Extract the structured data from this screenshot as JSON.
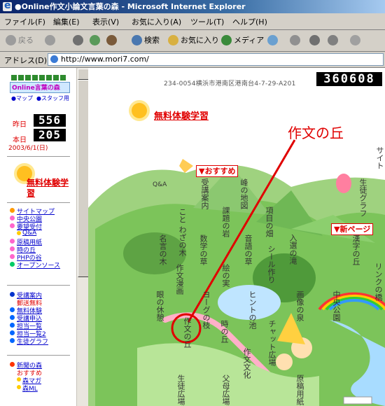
{
  "window": {
    "title": "●Online作文小論文言葉の森 - Microsoft Internet Explorer"
  },
  "menu": [
    "ファイル(F)",
    "編集(E)",
    "表示(V)",
    "お気に入り(A)",
    "ツール(T)",
    "ヘルプ(H)"
  ],
  "toolbar": {
    "back": "戻る",
    "search": "検索",
    "favorites": "お気に入り",
    "media": "メディア"
  },
  "address": {
    "label": "アドレス(D)",
    "url": "http://www.mori7.com/"
  },
  "sidebar": {
    "logo_text": "Online言葉の森",
    "mini_links": [
      "●マップ",
      "●スタッフ用"
    ],
    "yesterday_label": "昨日",
    "yesterday_count": "556",
    "today_label": "本日",
    "today_count": "205",
    "date": "2003/6/1(日)",
    "trial_label": "無料体験学習",
    "nav": [
      {
        "label": "サイトマップ",
        "color": "#ff9900",
        "indent": false
      },
      {
        "label": "中央公園",
        "color": "#ff66cc",
        "indent": false
      },
      {
        "label": "要望受付",
        "color": "#ff66cc",
        "indent": false
      },
      {
        "label": "Q&A",
        "color": "#ffcc00",
        "indent": true
      },
      {
        "label": "原稿用紙",
        "color": "#ff66cc",
        "indent": false
      },
      {
        "label": "時の丘",
        "color": "#ff66cc",
        "indent": false
      },
      {
        "label": "PHPの谷",
        "color": "#ff66cc",
        "indent": false
      },
      {
        "label": "オープンソース",
        "color": "#00cc66",
        "indent": false
      }
    ],
    "nav2": [
      {
        "label": "受講案内",
        "color": "#0033cc",
        "indent": false
      },
      {
        "label": "郵送無料",
        "color": "#ffffff",
        "indent": false,
        "plain": true
      },
      {
        "label": "無料体験",
        "color": "#0066ff",
        "indent": false
      },
      {
        "label": "受講申込",
        "color": "#0066ff",
        "indent": false
      },
      {
        "label": "担当一覧",
        "color": "#0066ff",
        "indent": false
      },
      {
        "label": "担当一覧2",
        "color": "#0066ff",
        "indent": false
      },
      {
        "label": "生徒グラフ",
        "color": "#0066ff",
        "indent": false
      }
    ],
    "nav3": [
      {
        "label": "新聞の森",
        "color": "#ff3300",
        "indent": false
      },
      {
        "label": "おすすめ",
        "color": "#ffffff",
        "indent": false,
        "plain": true
      },
      {
        "label": "森マガ",
        "color": "#ffcc00",
        "indent": true
      },
      {
        "label": "森ML",
        "color": "#ffcc00",
        "indent": true
      }
    ]
  },
  "main": {
    "postal_address": "234-0054横浜市港南区港南台4-7-29-A201",
    "total_count": "360608",
    "trial_label": "無料体験学習",
    "callout": "作文の丘",
    "badge_recommend": "▼おすすめ",
    "badge_new": "▼新ページ",
    "map_labels": [
      "受講案内",
      "峰の地図",
      "Q&A",
      "課題の岩",
      "こと わざの木",
      "作文の丘",
      "絵の実",
      "名言の木",
      "作文漫画",
      "シール作り",
      "入選の滝",
      "画像の泉",
      "漢字の丘",
      "リンクの橋",
      "中央公園",
      "時の丘",
      "ヒントの池",
      "チャット広場",
      "作文文化",
      "父母広場",
      "生徒広場",
      "原稿用紙",
      "眼の休憩",
      "ヨーグの枝",
      "数学の草",
      "音語の草",
      "項目の畑",
      "生徒グラフ",
      "サイト"
    ]
  }
}
